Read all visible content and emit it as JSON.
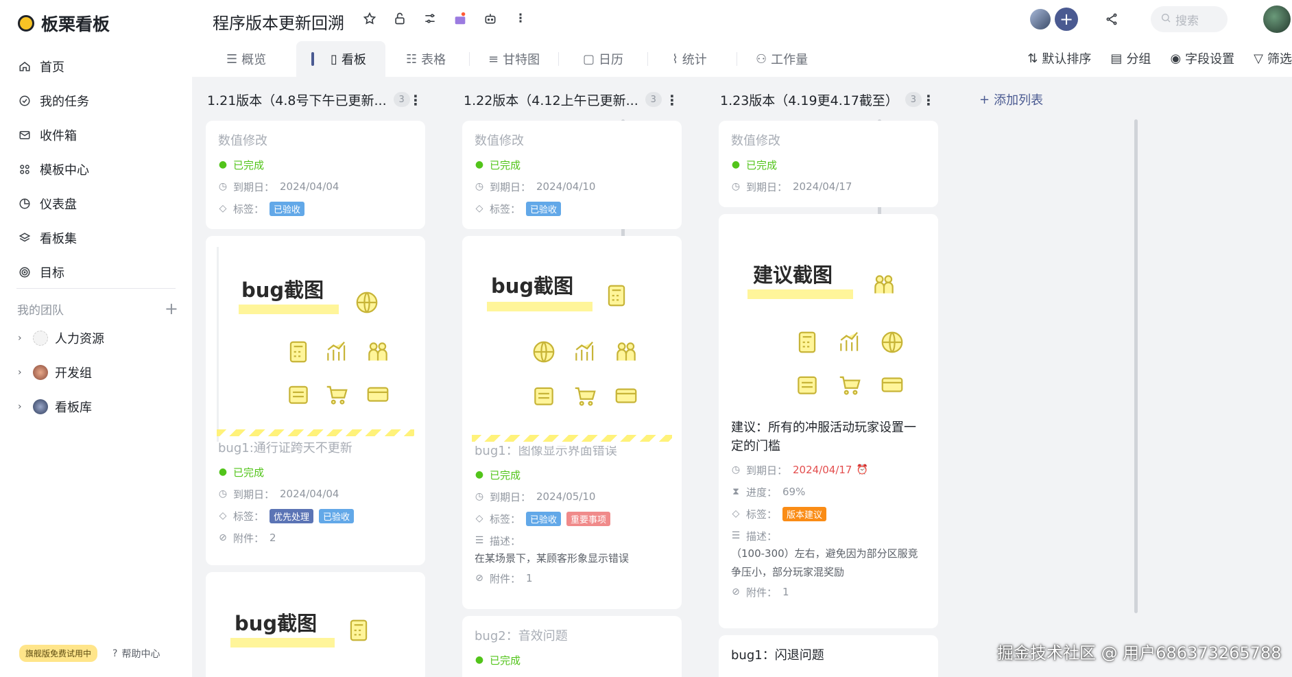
{
  "app": {
    "name": "板栗看板"
  },
  "nav": [
    {
      "label": "首页",
      "icon": "home-icon"
    },
    {
      "label": "我的任务",
      "icon": "check-circle-icon"
    },
    {
      "label": "收件箱",
      "icon": "inbox-icon"
    },
    {
      "label": "模板中心",
      "icon": "template-icon"
    },
    {
      "label": "仪表盘",
      "icon": "dashboard-icon"
    },
    {
      "label": "看板集",
      "icon": "layers-icon"
    },
    {
      "label": "目标",
      "icon": "target-icon"
    }
  ],
  "teams": {
    "heading": "我的团队",
    "items": [
      {
        "label": "人力资源"
      },
      {
        "label": "开发组"
      },
      {
        "label": "看板库"
      }
    ]
  },
  "footer": {
    "trial": "旗舰版免费试用中",
    "help": "帮助中心"
  },
  "header": {
    "title": "程序版本更新回溯",
    "search_placeholder": "搜索"
  },
  "tabs": [
    {
      "label": "概览"
    },
    {
      "label": "看板"
    },
    {
      "label": "表格"
    },
    {
      "label": "甘特图"
    },
    {
      "label": "日历"
    },
    {
      "label": "统计"
    },
    {
      "label": "工作量"
    }
  ],
  "view_tools": {
    "sort": "默认排序",
    "group": "分组",
    "fields": "字段设置",
    "filter": "筛选"
  },
  "labels": {
    "due": "到期日：",
    "tag": "标签：",
    "attach": "附件：",
    "progress": "进度：",
    "desc": "描述：",
    "done": "已完成"
  },
  "columns": [
    {
      "title": "1.21版本（4.8号下午已更新...",
      "count": "3",
      "cards": [
        {
          "title": "数值修改",
          "due": "2024/04/04",
          "tags": [
            "已验收"
          ]
        },
        {
          "image_title": "bug截图",
          "title": "bug1:通行证跨天不更新",
          "due": "2024/04/04",
          "tags": [
            "优先处理",
            "已验收"
          ],
          "attach": "2"
        },
        {
          "image_title": "bug截图"
        }
      ]
    },
    {
      "title": "1.22版本（4.12上午已更新...",
      "count": "3",
      "cards": [
        {
          "title": "数值修改",
          "due": "2024/04/10",
          "tags": [
            "已验收"
          ]
        },
        {
          "image_title": "bug截图",
          "title": "bug1：图像显示界面错误",
          "due": "2024/05/10",
          "tags": [
            "已验收",
            "重要事项"
          ],
          "desc": "在某场景下，某顾客形象显示错误",
          "attach": "1"
        },
        {
          "title": "bug2：音效问题"
        }
      ]
    },
    {
      "title": "1.23版本（4.19更4.17截至）",
      "count": "3",
      "cards": [
        {
          "title": "数值修改",
          "due": "2024/04/17"
        },
        {
          "image_title": "建议截图",
          "title": "建议：所有的冲服活动玩家设置一定的门槛",
          "due": "2024/04/17",
          "progress": "69%",
          "tags": [
            "版本建议"
          ],
          "desc": "（100-300）左右，避免因为部分区服竞争压小，部分玩家混奖励",
          "attach": "1"
        },
        {
          "title": "bug1：闪退问题"
        }
      ]
    }
  ],
  "add_list": "添加列表",
  "watermark": "掘金技术社区 @ 用户686373265788"
}
